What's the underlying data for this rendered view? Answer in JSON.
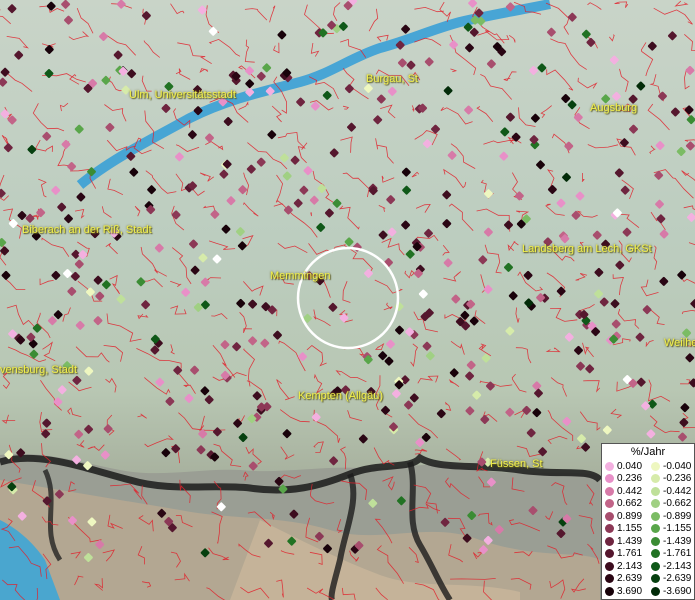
{
  "map": {
    "cities": [
      {
        "name": "Ulm, Universitätsstadt"
      },
      {
        "name": "Burgau, St"
      },
      {
        "name": "Augsburg"
      },
      {
        "name": "Biberach an der Riß, Stadt"
      },
      {
        "name": "Landsberg am Lech, GKSt"
      },
      {
        "name": "Memmingen"
      },
      {
        "name": "Weilhe"
      },
      {
        "name": "vensburg, Stadt"
      },
      {
        "name": "Kempten (Allgäu)"
      },
      {
        "name": "Füssen, St"
      }
    ],
    "colors": {
      "river": "#3aa0d6",
      "borders": "#e0212b",
      "label": "#f2f04a",
      "focus_circle": "#ffffff"
    }
  },
  "legend": {
    "title": "%/Jahr",
    "rows": [
      {
        "pos": "0.040",
        "pos_color": "#f3b0e0",
        "neg": "-0.040",
        "neg_color": "#eef7c0"
      },
      {
        "pos": "0.236",
        "pos_color": "#e890c8",
        "neg": "-0.236",
        "neg_color": "#d6ebaa"
      },
      {
        "pos": "0.442",
        "pos_color": "#d77aa8",
        "neg": "-0.442",
        "neg_color": "#bfe09a"
      },
      {
        "pos": "0.662",
        "pos_color": "#c26488",
        "neg": "-0.662",
        "neg_color": "#a0d083"
      },
      {
        "pos": "0.899",
        "pos_color": "#a84e6e",
        "neg": "-0.899",
        "neg_color": "#7bbc64"
      },
      {
        "pos": "1.155",
        "pos_color": "#8c3856",
        "neg": "-1.155",
        "neg_color": "#59a64a"
      },
      {
        "pos": "1.439",
        "pos_color": "#6f2540",
        "neg": "-1.439",
        "neg_color": "#3b8c34"
      },
      {
        "pos": "1.761",
        "pos_color": "#55172e",
        "neg": "-1.761",
        "neg_color": "#217223"
      },
      {
        "pos": "2.143",
        "pos_color": "#3d0d1f",
        "neg": "-2.143",
        "neg_color": "#0f5818"
      },
      {
        "pos": "2.639",
        "pos_color": "#2a0614",
        "neg": "-2.639",
        "neg_color": "#06400f"
      },
      {
        "pos": "3.690",
        "pos_color": "#18020a",
        "neg": "-3.690",
        "neg_color": "#022b08"
      }
    ]
  }
}
